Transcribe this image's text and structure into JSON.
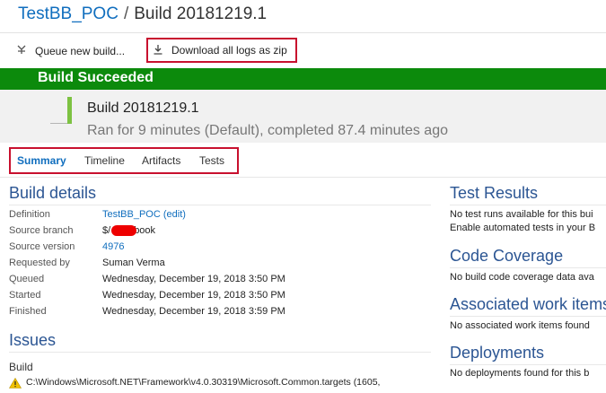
{
  "breadcrumb": {
    "project": "TestBB_POC",
    "separator": "/",
    "build": "Build 20181219.1"
  },
  "toolbar": {
    "queue_label": "Queue new build...",
    "download_label": "Download all logs as zip"
  },
  "status": {
    "text": "Build Succeeded",
    "color": "#0c8a0c",
    "result_color": "#7dc242"
  },
  "build": {
    "number": "Build 20181219.1",
    "duration": "Ran for 9 minutes (Default), completed 87.4 minutes ago"
  },
  "tabs": [
    {
      "label": "Summary",
      "selected": true
    },
    {
      "label": "Timeline"
    },
    {
      "label": "Artifacts"
    },
    {
      "label": "Tests"
    }
  ],
  "build_details": {
    "title": "Build details",
    "rows": [
      {
        "label": "Definition",
        "value": "TestBB_POC (edit)",
        "link": true
      },
      {
        "label": "Source branch",
        "value": "$/",
        "value_suffix": "book",
        "redacted": true
      },
      {
        "label": "Source version",
        "value": "4976",
        "link": true
      },
      {
        "label": "Requested by",
        "value": "Suman Verma"
      },
      {
        "label": "Queued",
        "value": "Wednesday, December 19, 2018 3:50 PM"
      },
      {
        "label": "Started",
        "value": "Wednesday, December 19, 2018 3:50 PM"
      },
      {
        "label": "Finished",
        "value": "Wednesday, December 19, 2018 3:59 PM"
      }
    ]
  },
  "issues": {
    "title": "Issues",
    "group": "Build",
    "items": [
      {
        "icon": "warning-icon",
        "text": "C:\\Windows\\Microsoft.NET\\Framework\\v4.0.30319\\Microsoft.Common.targets (1605,"
      }
    ]
  },
  "right": {
    "test_results": {
      "title": "Test Results",
      "line1": "No test runs available for this bui",
      "line2": "Enable automated tests in your B"
    },
    "code_coverage": {
      "title": "Code Coverage",
      "line1": "No build code coverage data ava"
    },
    "work_items": {
      "title": "Associated work items",
      "line1": "No associated work items found"
    },
    "deployments": {
      "title": "Deployments",
      "line1": "No deployments found for this b"
    }
  }
}
